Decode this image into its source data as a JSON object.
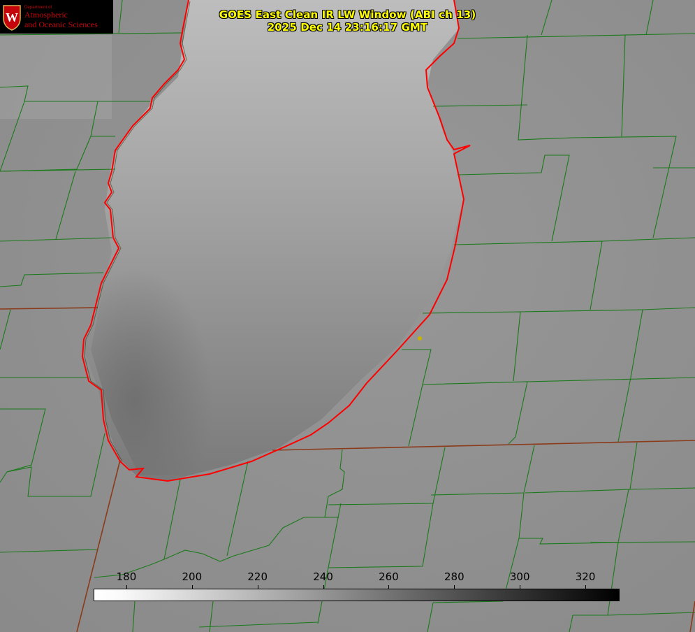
{
  "title_line1": "GOES East Clean IR LW Window (ABI ch 13)",
  "title_line2": "2025 Dec 14 23:16:17 GMT",
  "logo": {
    "department": "Department of",
    "line1": "Atmospheric",
    "line2": "and Oceanic Sciences",
    "seal_letter": "W"
  },
  "colorbar": {
    "min": 170,
    "max": 330,
    "ticks": [
      {
        "label": "180",
        "value": 180
      },
      {
        "label": "200",
        "value": 200
      },
      {
        "label": "220",
        "value": 220
      },
      {
        "label": "240",
        "value": 240
      },
      {
        "label": "260",
        "value": 260
      },
      {
        "label": "280",
        "value": 280
      },
      {
        "label": "300",
        "value": 300
      },
      {
        "label": "320",
        "value": 320
      }
    ]
  },
  "colors": {
    "county_lines": "#1a7a1a",
    "state_lines": "#8b3a1a",
    "lake_outline": "#ff0000",
    "title_text": "#ffff00",
    "station_marker": "#c8b400"
  },
  "icons": {
    "station": "dot-icon",
    "seal": "university-seal-icon"
  }
}
